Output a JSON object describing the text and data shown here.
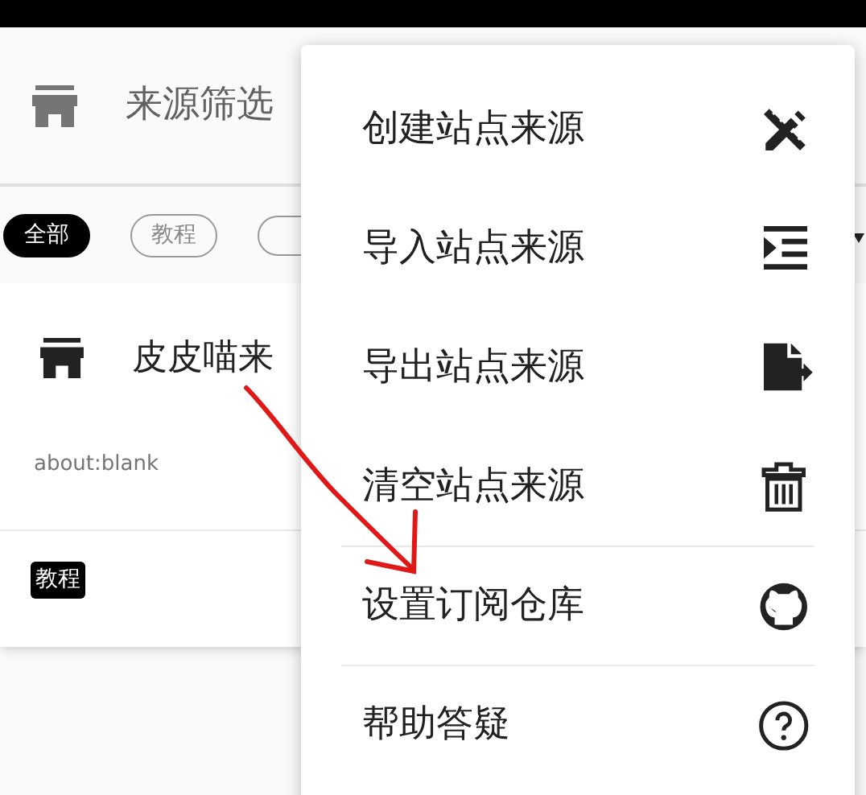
{
  "header": {
    "title": "来源筛选"
  },
  "chips": [
    {
      "label": "全部",
      "selected": true
    },
    {
      "label": "教程",
      "selected": false
    }
  ],
  "card": {
    "title": "皮皮喵来",
    "url": "about:blank",
    "tag": "教程"
  },
  "menu": [
    {
      "label": "创建站点来源",
      "divider_before": false
    },
    {
      "label": "导入站点来源",
      "divider_before": false
    },
    {
      "label": "导出站点来源",
      "divider_before": false
    },
    {
      "label": "清空站点来源",
      "divider_before": false
    },
    {
      "label": "设置订阅仓库",
      "divider_before": true
    },
    {
      "label": "帮助答疑",
      "divider_before": true
    }
  ]
}
